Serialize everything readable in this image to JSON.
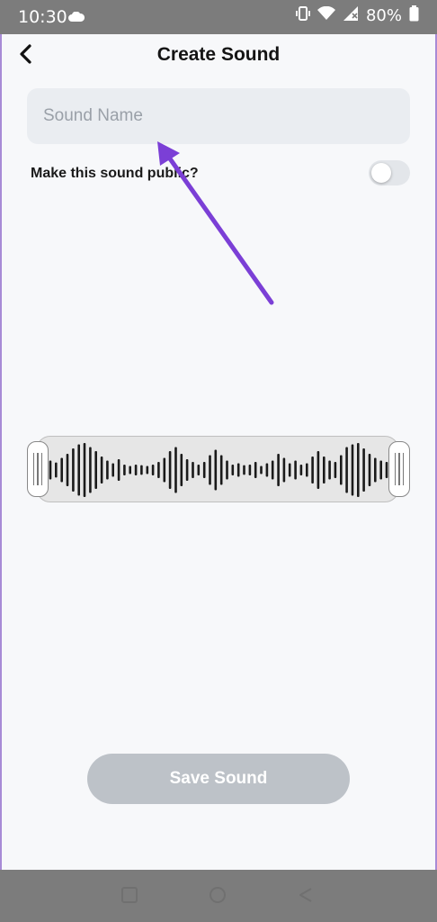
{
  "status_bar": {
    "time": "10:30",
    "battery": "80%",
    "icons": [
      "cloud-icon",
      "vibrate-icon",
      "wifi-icon",
      "signal-icon",
      "battery-icon"
    ]
  },
  "header": {
    "title": "Create Sound",
    "back_icon": "chevron-left-icon"
  },
  "form": {
    "sound_name_value": "",
    "sound_name_placeholder": "Sound Name",
    "public_label": "Make this sound public?",
    "public_toggle_on": false
  },
  "waveform": {
    "amplitudes": [
      0.35,
      0.28,
      0.45,
      0.6,
      0.8,
      0.95,
      1.0,
      0.85,
      0.7,
      0.5,
      0.35,
      0.25,
      0.4,
      0.2,
      0.15,
      0.2,
      0.18,
      0.15,
      0.2,
      0.3,
      0.45,
      0.7,
      0.85,
      0.6,
      0.4,
      0.3,
      0.2,
      0.3,
      0.55,
      0.75,
      0.55,
      0.35,
      0.2,
      0.25,
      0.18,
      0.2,
      0.3,
      0.15,
      0.25,
      0.35,
      0.6,
      0.45,
      0.25,
      0.35,
      0.2,
      0.25,
      0.5,
      0.7,
      0.5,
      0.35,
      0.3,
      0.55,
      0.85,
      0.95,
      1.0,
      0.8,
      0.6,
      0.45,
      0.35,
      0.3
    ]
  },
  "actions": {
    "save_label": "Save Sound"
  },
  "nav_bar": {
    "icons": [
      "recents-square-icon",
      "home-circle-icon",
      "back-triangle-icon"
    ]
  },
  "colors": {
    "annotation_arrow": "#7b3fd6",
    "save_disabled": "#bdc2c8",
    "input_bg": "#eaedf1"
  }
}
